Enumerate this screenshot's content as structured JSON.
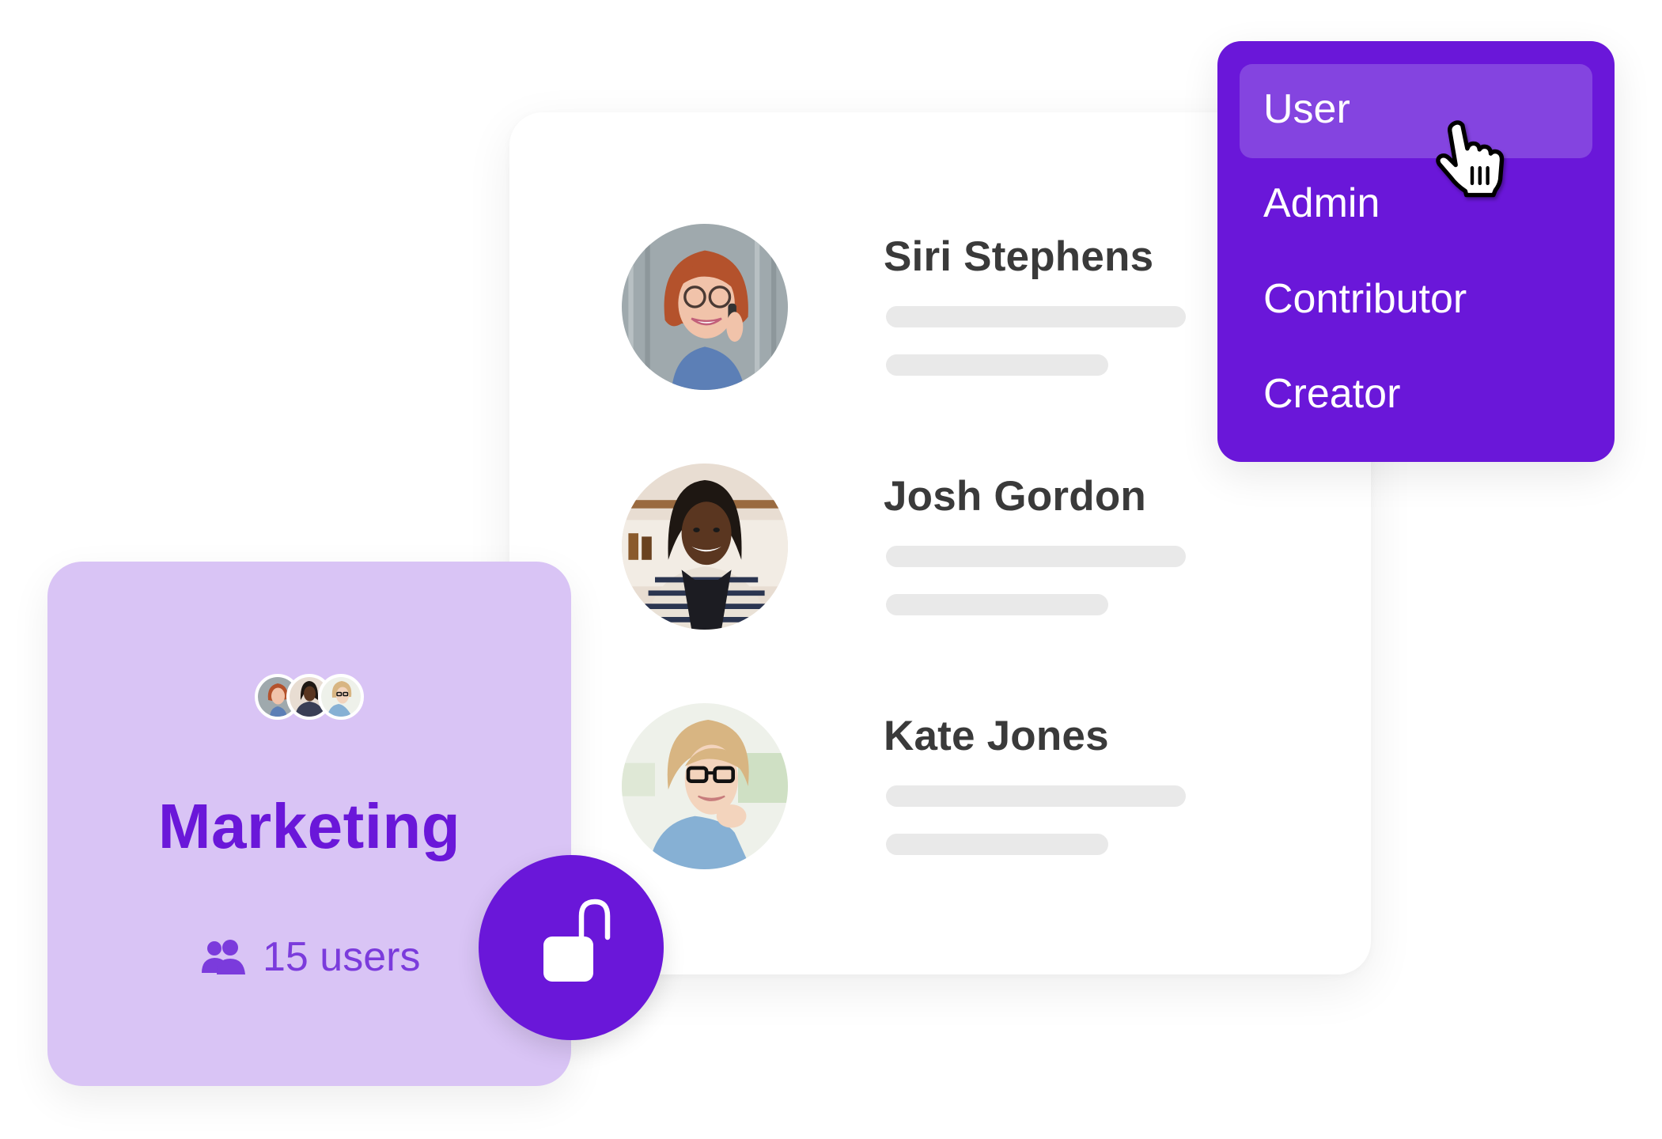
{
  "colors": {
    "accent": "#6a17d9",
    "menu_highlight": "#8444e0",
    "group_card_bg": "#d9c4f5",
    "user_count_text": "#7b3bdc",
    "name_text": "#3a3a3a",
    "placeholder_bar": "#e9e9e9"
  },
  "users": [
    {
      "name": "Siri Stephens",
      "avatar": "avatar-siri"
    },
    {
      "name": "Josh Gordon",
      "avatar": "avatar-josh"
    },
    {
      "name": "Kate Jones",
      "avatar": "avatar-kate"
    }
  ],
  "role_menu": {
    "selected": "User",
    "items": [
      {
        "label": "User"
      },
      {
        "label": "Admin"
      },
      {
        "label": "Contributor"
      },
      {
        "label": "Creator"
      }
    ]
  },
  "cursor": {
    "icon": "pointer-hand-icon"
  },
  "group": {
    "title": "Marketing",
    "user_count_label": "15 users",
    "users_icon": "users-icon",
    "member_avatars": [
      "avatar-siri",
      "avatar-josh",
      "avatar-kate"
    ]
  },
  "lock_button": {
    "icon": "unlocked-padlock-icon",
    "state": "unlocked"
  }
}
